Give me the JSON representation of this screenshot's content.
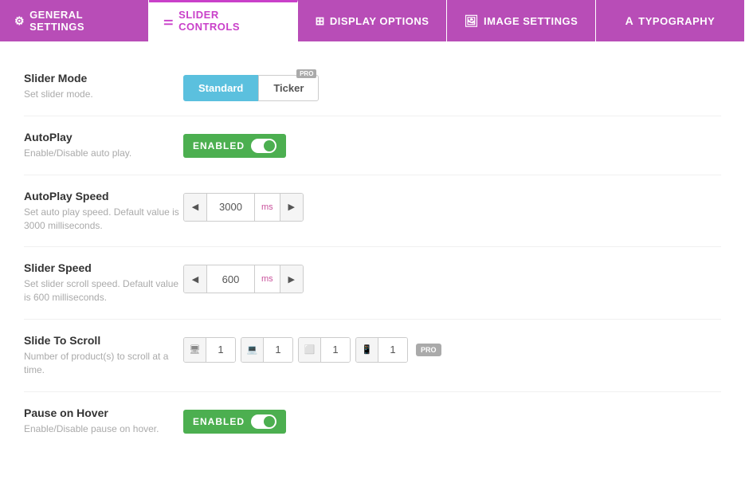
{
  "tabs": [
    {
      "id": "general",
      "label": "GENERAL SETTINGS",
      "icon": "⚙",
      "active": false
    },
    {
      "id": "slider",
      "label": "SLIDER CONTROLS",
      "icon": "≡",
      "active": true
    },
    {
      "id": "display",
      "label": "DISPLAY OPTIONS",
      "icon": "⊞",
      "active": false
    },
    {
      "id": "image",
      "label": "IMAGE SETTINGS",
      "icon": "🖼",
      "active": false
    },
    {
      "id": "typography",
      "label": "TYPOGRAPHY",
      "icon": "A",
      "active": false
    }
  ],
  "settings": {
    "slider_mode": {
      "label": "Slider Mode",
      "desc": "Set slider mode.",
      "options": [
        "Standard",
        "Ticker"
      ],
      "selected": "Standard"
    },
    "autoplay": {
      "label": "AutoPlay",
      "desc": "Enable/Disable auto play.",
      "enabled": true,
      "enabled_label": "ENABLED"
    },
    "autoplay_speed": {
      "label": "AutoPlay Speed",
      "desc": "Set auto play speed. Default value is 3000 milliseconds.",
      "value": "3000",
      "unit": "ms"
    },
    "slider_speed": {
      "label": "Slider Speed",
      "desc": "Set slider scroll speed. Default value is 600 milliseconds.",
      "value": "600",
      "unit": "ms"
    },
    "slide_to_scroll": {
      "label": "Slide To Scroll",
      "desc": "Number of product(s) to scroll at a time.",
      "values": [
        "1",
        "1",
        "1",
        "1"
      ]
    },
    "pause_on_hover": {
      "label": "Pause on Hover",
      "desc": "Enable/Disable pause on hover.",
      "enabled": true,
      "enabled_label": "ENABLED"
    }
  },
  "labels": {
    "standard": "Standard",
    "ticker": "Ticker",
    "pro": "PRO",
    "ms": "ms",
    "enabled": "ENABLED"
  }
}
